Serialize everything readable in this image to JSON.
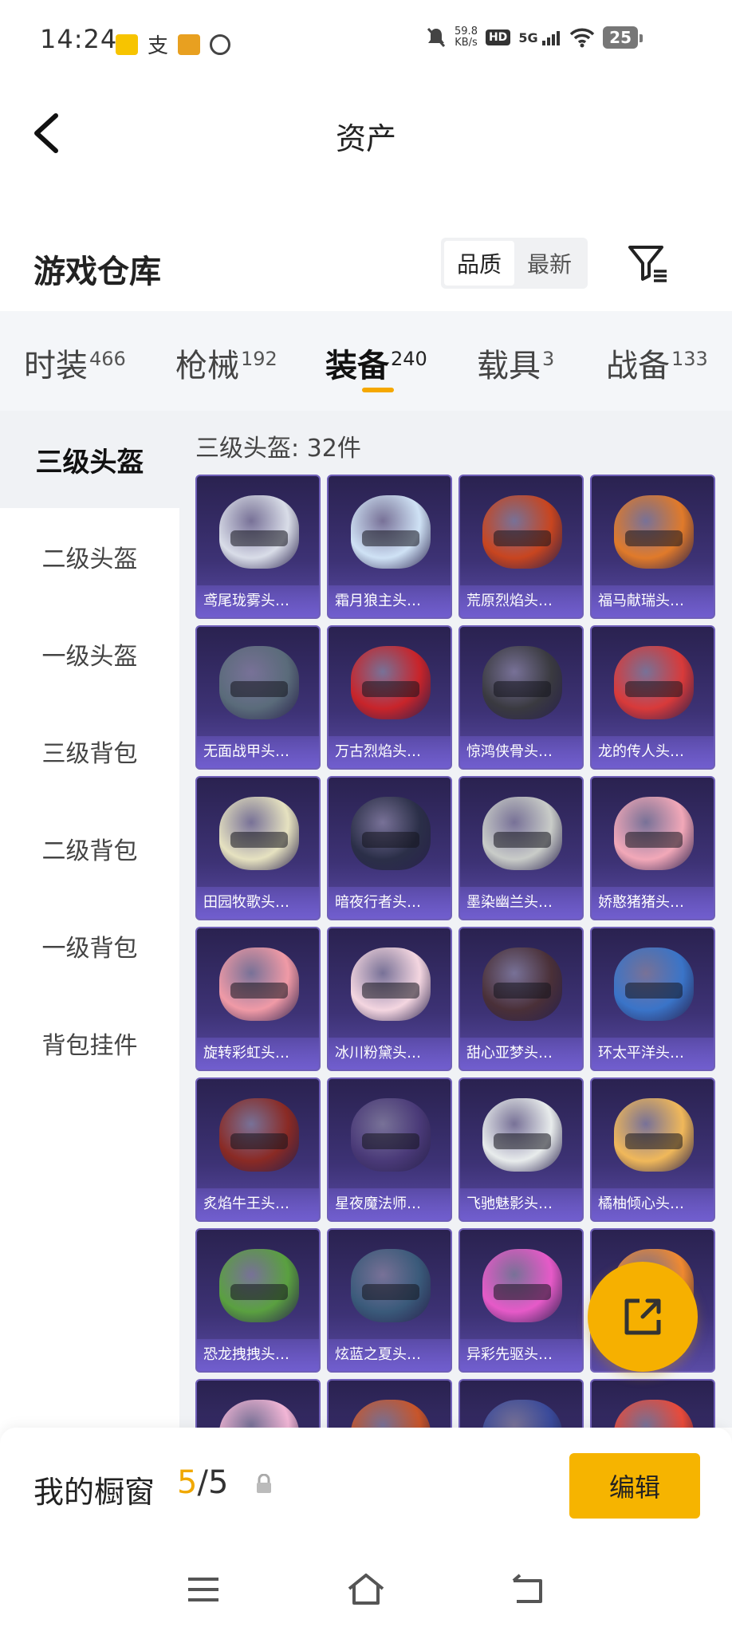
{
  "status_bar": {
    "time": "14:24",
    "net_speed_value": "59.8",
    "net_speed_unit": "KB/s",
    "hd_label": "HD",
    "network": "5G",
    "battery": "25"
  },
  "nav": {
    "title": "资产"
  },
  "section": {
    "title": "游戏仓库",
    "sort_options": [
      "品质",
      "最新"
    ],
    "active_sort": "品质"
  },
  "category_tabs": [
    {
      "label": "时装",
      "count": "466"
    },
    {
      "label": "枪械",
      "count": "192"
    },
    {
      "label": "装备",
      "count": "240"
    },
    {
      "label": "载具",
      "count": "3"
    },
    {
      "label": "战备",
      "count": "133"
    }
  ],
  "active_tab": "装备",
  "side_nav": [
    "三级头盔",
    "二级头盔",
    "一级头盔",
    "三级背包",
    "二级背包",
    "一级背包",
    "背包挂件"
  ],
  "active_side": "三级头盔",
  "content": {
    "count_label": "三级头盔: 32件",
    "items": [
      {
        "name": "鸢尾珑雾头…",
        "color": "#d9dde8"
      },
      {
        "name": "霜月狼主头…",
        "color": "#cfe2f5"
      },
      {
        "name": "荒原烈焰头…",
        "color": "#c8451f"
      },
      {
        "name": "福马献瑞头…",
        "color": "#e07a2a"
      },
      {
        "name": "无面战甲头…",
        "color": "#5a6b7a"
      },
      {
        "name": "万古烈焰头…",
        "color": "#c8242a"
      },
      {
        "name": "惊鸿侠骨头…",
        "color": "#3a3a40"
      },
      {
        "name": "龙的传人头…",
        "color": "#d83a3a"
      },
      {
        "name": "田园牧歌头…",
        "color": "#e6e2c0"
      },
      {
        "name": "暗夜行者头…",
        "color": "#2b2f48"
      },
      {
        "name": "墨染幽兰头…",
        "color": "#c9ccc8"
      },
      {
        "name": "娇憨猪猪头…",
        "color": "#f2a8b8"
      },
      {
        "name": "旋转彩虹头…",
        "color": "#f09aa6"
      },
      {
        "name": "冰川粉黛头…",
        "color": "#f4d6e0"
      },
      {
        "name": "甜心亚梦头…",
        "color": "#4a3038"
      },
      {
        "name": "环太平洋头…",
        "color": "#3a74c8"
      },
      {
        "name": "炙焰牛王头…",
        "color": "#8a2a24"
      },
      {
        "name": "星夜魔法师…",
        "color": "#4a3a78"
      },
      {
        "name": "飞驰魅影头…",
        "color": "#e8ecec"
      },
      {
        "name": "橘柚倾心头…",
        "color": "#f0b85a"
      },
      {
        "name": "恐龙拽拽头…",
        "color": "#5aa040"
      },
      {
        "name": "炫蓝之夏头…",
        "color": "#3a5a7a"
      },
      {
        "name": "异彩先驱头…",
        "color": "#e65ac8"
      },
      {
        "name": "",
        "color": "#f08a30"
      },
      {
        "name": "",
        "color": "#f2b6d6"
      },
      {
        "name": "",
        "color": "#c8552a"
      },
      {
        "name": "",
        "color": "#3a4a9a"
      },
      {
        "name": "",
        "color": "#e84a3a"
      }
    ]
  },
  "showcase": {
    "label": "我的橱窗",
    "current": "5",
    "separator": "/",
    "max": "5",
    "edit_label": "编辑"
  },
  "colors": {
    "accent": "#f6b400",
    "card_bg": "#3d3275",
    "side_active_bg": "#f0f2f5"
  }
}
